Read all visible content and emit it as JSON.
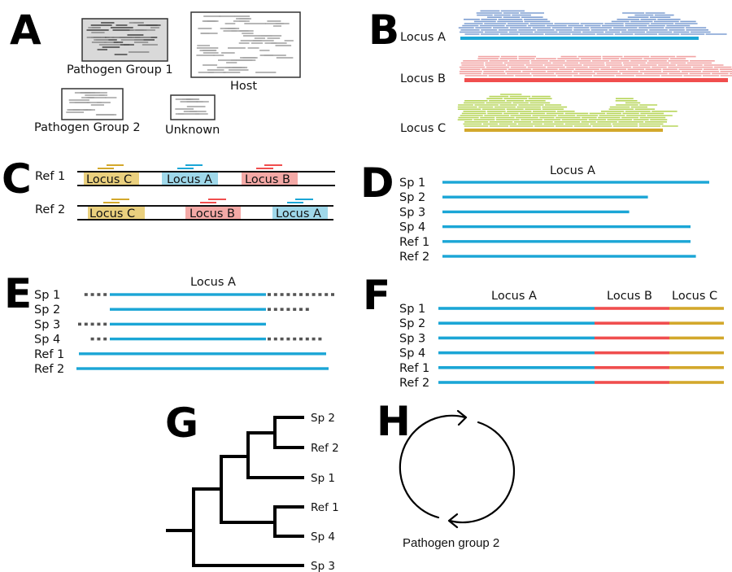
{
  "colors": {
    "locus_a": "#1ba6d6",
    "locus_b": "#f04e4e",
    "locus_c": "#d3a82c",
    "locus_a_fill": "#9fd8ea",
    "locus_b_fill": "#f4a9a6",
    "locus_c_fill": "#ead07e",
    "reads_a": "#7f9fd2",
    "reads_b": "#f1a3a3",
    "reads_c": "#b7d55a",
    "dots": "#555555",
    "gray_box": "#d9d9d9"
  },
  "panels": {
    "A": {
      "letter": "A",
      "bins": [
        {
          "label": "Pathogen Group 1",
          "shaded": true
        },
        {
          "label": "Host",
          "shaded": false
        },
        {
          "label": "Pathogen Group 2",
          "shaded": false
        },
        {
          "label": "Unknown",
          "shaded": false
        }
      ]
    },
    "B": {
      "letter": "B",
      "loci": [
        {
          "label": "Locus A"
        },
        {
          "label": "Locus B"
        },
        {
          "label": "Locus C"
        }
      ]
    },
    "C": {
      "letter": "C",
      "refs": [
        {
          "label": "Ref 1",
          "loci": [
            "Locus C",
            "Locus A",
            "Locus B"
          ]
        },
        {
          "label": "Ref 2",
          "loci": [
            "Locus C",
            "Locus B",
            "Locus A"
          ]
        }
      ]
    },
    "D": {
      "letter": "D",
      "title": "Locus A",
      "rows": [
        {
          "label": "Sp 1",
          "length_fraction": 1.0
        },
        {
          "label": "Sp 2",
          "length_fraction": 0.77
        },
        {
          "label": "Sp 3",
          "length_fraction": 0.7
        },
        {
          "label": "Sp 4",
          "length_fraction": 0.93
        },
        {
          "label": "Ref 1",
          "length_fraction": 0.93
        },
        {
          "label": "Ref 2",
          "length_fraction": 0.95
        }
      ]
    },
    "E": {
      "letter": "E",
      "title": "Locus A",
      "rows": [
        {
          "label": "Sp 1",
          "trimmed": true,
          "left_dots": 4,
          "right_dots": 11
        },
        {
          "label": "Sp 2",
          "trimmed": true,
          "left_dots": 0,
          "right_dots": 7
        },
        {
          "label": "Sp 3",
          "trimmed": true,
          "left_dots": 5,
          "right_dots": 0
        },
        {
          "label": "Sp 4",
          "trimmed": true,
          "left_dots": 3,
          "right_dots": 9
        },
        {
          "label": "Ref 1",
          "trimmed": false
        },
        {
          "label": "Ref 2",
          "trimmed": false
        }
      ]
    },
    "F": {
      "letter": "F",
      "headers": [
        "Locus A",
        "Locus B",
        "Locus C"
      ],
      "rows": [
        "Sp 1",
        "Sp 2",
        "Sp 3",
        "Sp 4",
        "Ref 1",
        "Ref 2"
      ]
    },
    "G": {
      "letter": "G",
      "tips": [
        "Sp 2",
        "Ref 2",
        "Sp 1",
        "Ref 1",
        "Sp 4",
        "Sp 3"
      ],
      "newick": "(((((Sp 2,Ref 2),Sp 1),(Ref 1,Sp 4)),Sp 3));"
    },
    "H": {
      "letter": "H",
      "caption": "Pathogen group 2"
    }
  }
}
